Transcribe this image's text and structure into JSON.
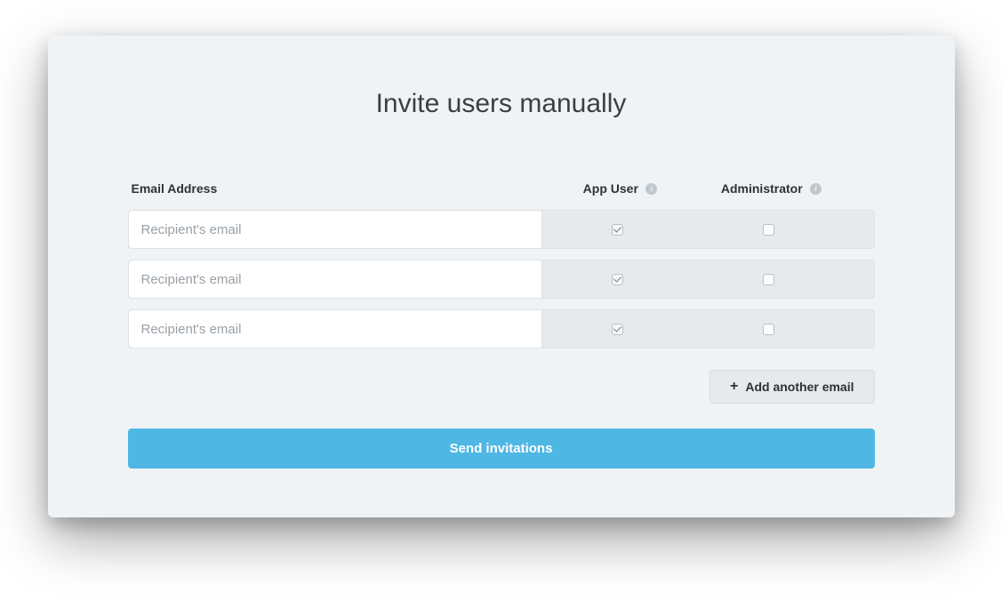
{
  "title": "Invite users manually",
  "headers": {
    "email": "Email Address",
    "app_user": "App User",
    "admin": "Administrator"
  },
  "rows": [
    {
      "placeholder": "Recipient's email",
      "value": "",
      "app_user": true,
      "admin": false
    },
    {
      "placeholder": "Recipient's email",
      "value": "",
      "app_user": true,
      "admin": false
    },
    {
      "placeholder": "Recipient's email",
      "value": "",
      "app_user": true,
      "admin": false
    }
  ],
  "buttons": {
    "add": "Add another email",
    "send": "Send invitations"
  },
  "info_glyph": "i"
}
